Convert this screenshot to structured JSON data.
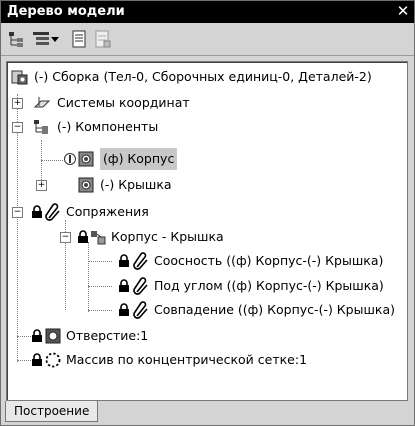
{
  "window": {
    "title": "Дерево модели"
  },
  "toolbar": {
    "buttons": [
      "tree-structure-icon",
      "tree-view-icon",
      "dropdown-arrow-icon",
      "list-icon",
      "properties-icon"
    ]
  },
  "tree": {
    "root": "(-) Сборка (Тел-0, Сборочных единиц-0, Деталей-2)",
    "coord": "Системы координат",
    "components": "(-) Компоненты",
    "korpus": "(ф) Корпус",
    "kryshka": "(-) Крышка",
    "mates": "Сопряжения",
    "mate_pair": "Корпус - Крышка",
    "m1": "Соосность ((ф) Корпус-(-) Крышка)",
    "m2": "Под углом ((ф) Корпус-(-) Крышка)",
    "m3": "Совпадение ((ф) Корпус-(-) Крышка)",
    "hole": "Отверстие:1",
    "array": "Массив по концентрической сетке:1"
  },
  "tabs": {
    "build": "Построение"
  }
}
